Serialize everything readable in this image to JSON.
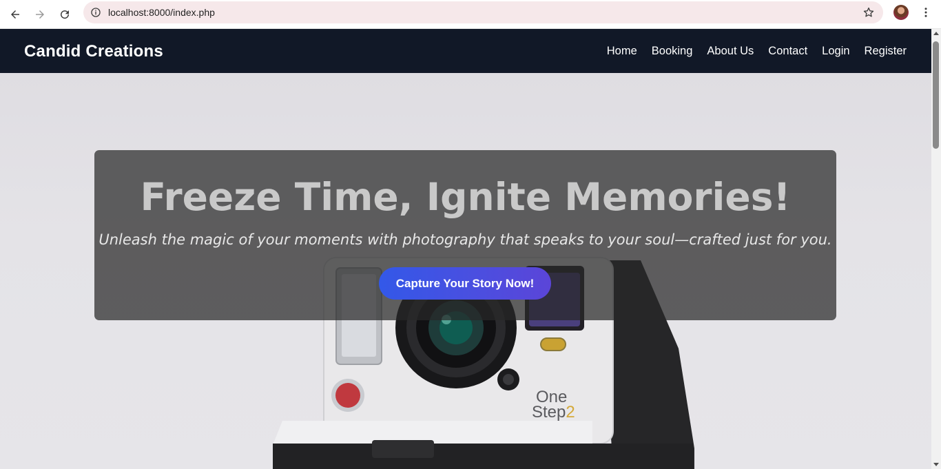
{
  "browser": {
    "url": "localhost:8000/index.php",
    "icons": {
      "back": "arrow-left-icon",
      "forward": "arrow-right-icon",
      "reload": "reload-icon",
      "site_info": "info-icon",
      "bookmark": "star-icon",
      "menu": "kebab-menu-icon"
    }
  },
  "navbar": {
    "brand": "Candid Creations",
    "links": [
      "Home",
      "Booking",
      "About Us",
      "Contact",
      "Login",
      "Register"
    ]
  },
  "hero": {
    "headline": "Freeze Time, Ignite Memories!",
    "tagline": "Unleash the magic of your moments with photography that speaks to your soul—crafted just for you.",
    "cta_label": "Capture Your Story Now!",
    "camera_brand": "One",
    "camera_model": "Step",
    "camera_model_number": "2"
  },
  "colors": {
    "navbar_bg": "#111827",
    "cta_start": "#3358e8",
    "cta_end": "#5b45d8",
    "overlay": "rgba(40,40,40,0.72)"
  }
}
